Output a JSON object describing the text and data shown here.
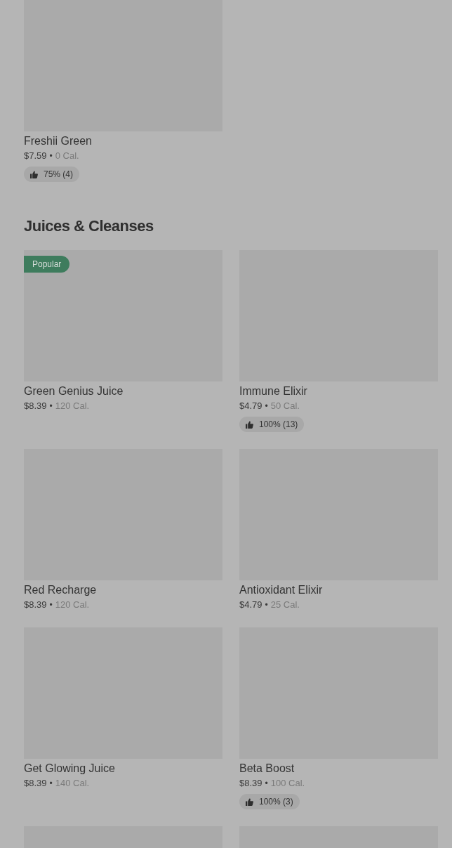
{
  "sections": [
    {
      "items": [
        {
          "name": "Freshii Green",
          "price": "$7.59",
          "separator": "•",
          "calories": "0 Cal.",
          "rating": "75% (4)"
        }
      ]
    },
    {
      "title": "Juices & Cleanses",
      "items": [
        {
          "name": "Green Genius Juice",
          "price": "$8.39",
          "separator": "•",
          "calories": "120 Cal.",
          "badge": "Popular"
        },
        {
          "name": "Immune Elixir",
          "price": "$4.79",
          "separator": "•",
          "calories": "50 Cal.",
          "rating": "100% (13)"
        },
        {
          "name": "Red Recharge",
          "price": "$8.39",
          "separator": "•",
          "calories": "120 Cal."
        },
        {
          "name": "Antioxidant Elixir",
          "price": "$4.79",
          "separator": "•",
          "calories": "25 Cal."
        },
        {
          "name": "Get Glowing Juice",
          "price": "$8.39",
          "separator": "•",
          "calories": "140 Cal."
        },
        {
          "name": "Beta Boost",
          "price": "$8.39",
          "separator": "•",
          "calories": "100 Cal.",
          "rating": "100% (3)"
        },
        {
          "kind": "picture"
        },
        {
          "kind": "picture"
        }
      ]
    }
  ]
}
